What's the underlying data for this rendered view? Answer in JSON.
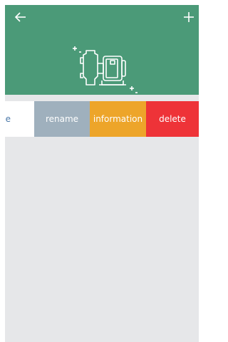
{
  "header": {
    "back_icon": "arrow-left-icon",
    "add_icon": "plus-icon",
    "illustration": "pump-icon",
    "bg_color": "#4b9a78"
  },
  "row": {
    "name_fragment": "ne",
    "actions": {
      "rename": "rename",
      "information": "information",
      "delete": "delete"
    },
    "colors": {
      "rename": "#9fb0bd",
      "information": "#eda52a",
      "delete": "#ee3338"
    }
  }
}
